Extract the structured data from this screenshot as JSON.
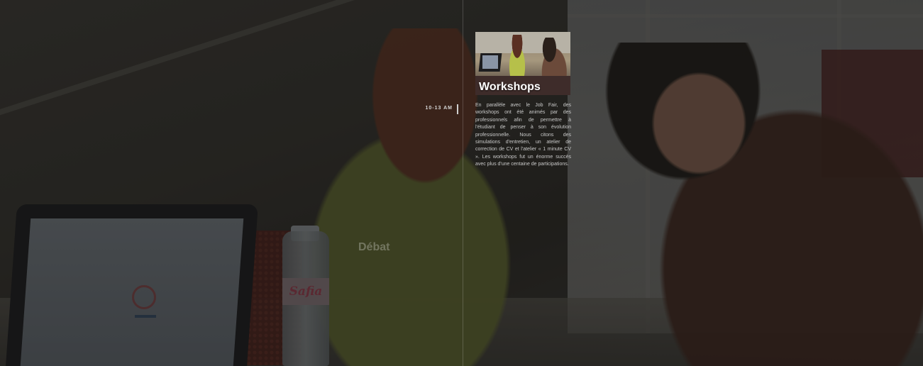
{
  "timeline": {
    "line_color": "#ffffff",
    "items": [
      {
        "time": "10-13 AM",
        "title": "Workshops",
        "text": "En parallèle avec le Job Fair, des workshops ont été animés par des professionnels afin de permettre à l'étudiant de penser à son évolution professionnelle. Nous citons des simulations d'entretien, un atelier de correction de CV et l'atelier « 1 minute CV ». Les workshops fut un énorme succès avec plus d'une centaine de participations.",
        "image_icon": "workshop-photo"
      },
      {
        "title": "Débat",
        "text": ""
      }
    ]
  },
  "background": {
    "bottle_label": "Safia",
    "overlay_color": "#0a0a0a"
  }
}
